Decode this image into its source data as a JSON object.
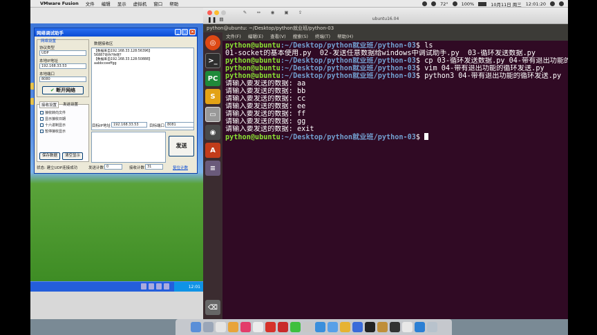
{
  "mac_menubar": {
    "app_name": "VMware Fusion",
    "items": [
      "文件",
      "编辑",
      "显示",
      "虚拟机",
      "窗口",
      "帮助"
    ],
    "status": {
      "temp": "72°",
      "battery": "100%",
      "date": "10月11日 周三",
      "time": "12:01:20"
    }
  },
  "vmware_window": {
    "title": "ubuntu16.04"
  },
  "ubuntu_topbar": {
    "title": "python@ubuntu: ~/Desktop/python就业班/python-03"
  },
  "terminal_menu": [
    "文件(F)",
    "编辑(E)",
    "查看(V)",
    "搜索(S)",
    "终端(T)",
    "帮助(H)"
  ],
  "terminal": {
    "prompt_user": "python@ubuntu",
    "prompt_path": ":~/Desktop/python就业班/python-03",
    "prompt_dollar": "$ ",
    "lines": [
      {
        "type": "cmd",
        "text": "ls"
      },
      {
        "type": "out",
        "text": "01-socket的基本使用.py  02-发送任意数据给windows中调试助手.py  03-循环发送数据.py"
      },
      {
        "type": "cmd",
        "text": "cp 03-循环发送数据.py 04-带有退出功能的循环发送.py"
      },
      {
        "type": "cmd",
        "text": "vim 04-带有退出功能的循环发送.py"
      },
      {
        "type": "cmd",
        "text": "python3 04-带有退出功能的循环发送.py"
      },
      {
        "type": "out",
        "text": "请输入要发送的数据: aa"
      },
      {
        "type": "out",
        "text": "请输入要发送的数据: bb"
      },
      {
        "type": "out",
        "text": "请输入要发送的数据: cc"
      },
      {
        "type": "out",
        "text": "请输入要发送的数据: ee"
      },
      {
        "type": "out",
        "text": "请输入要发送的数据: ff"
      },
      {
        "type": "out",
        "text": "请输入要发送的数据: gg"
      },
      {
        "type": "out",
        "text": "请输入要发送的数据: exit"
      },
      {
        "type": "cmd",
        "text": ""
      }
    ]
  },
  "net_assistant": {
    "title": "网络调试助手",
    "group_net_settings": "网络设置",
    "protocol_label": "协议类型",
    "protocol_value": "UDP",
    "local_ip_label": "本地IP地址",
    "local_ip_value": "192.168.33.53",
    "local_port_label": "本地端口",
    "local_port_value": "8080",
    "open_button": "断开网络",
    "recv_settings_tab": "接收设置",
    "send_settings_tab": "发送设置",
    "options": [
      "接收转向文件",
      "显示接收日期",
      "十六进制显示",
      "暂停接收显示"
    ],
    "save_button": "保存数据",
    "clear_button": "清空显示",
    "recv_area_label": "数据接收区",
    "recv_lines": [
      "【数据来自192.168.33.128:56396】",
      "56887哥你?你呢?",
      "【数据来自192.168.33.128:50888】",
      "aabbcceeffgg"
    ],
    "target_ip_label": "目标IP地址",
    "target_ip_value": "192.168.33.53",
    "target_port_label": "目标端口",
    "target_port_value": "8081",
    "send_button": "发送",
    "status_text": "状态: 建立UDP连接成功",
    "send_count_label": "发送计数",
    "send_count": "0",
    "recv_count_label": "接收计数",
    "recv_count": "31",
    "reset_count": "复位计数"
  },
  "xp_taskbar": {
    "clock": "12:01"
  }
}
